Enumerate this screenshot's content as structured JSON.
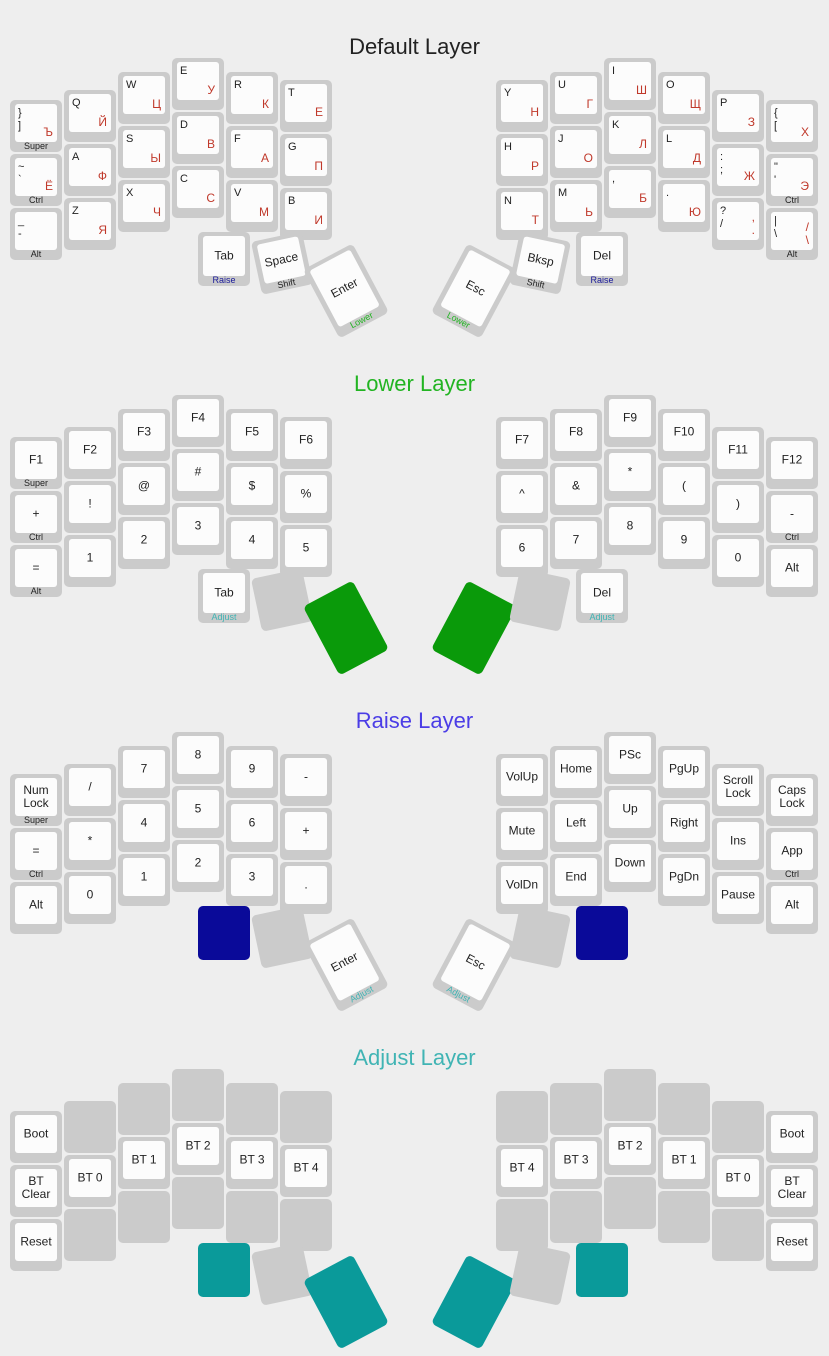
{
  "colors": {
    "default_title": "#222222",
    "lower": "#22b422",
    "lower_fill": "#0a9a0a",
    "raise": "#4b3de6",
    "raise_fill": "#0a0a99",
    "adjust": "#40b4b4",
    "adjust_fill": "#0a9a9a",
    "hold_raise": "#1a1a99",
    "hold_lower": "#22b422",
    "hold_adjust": "#40b4b4",
    "hold_plain": "#222222",
    "cyrillic": "#c0392b"
  },
  "layers": [
    {
      "title": "Default Layer",
      "color": "#222222",
      "left": [
        {
          "tl": "}\n]",
          "br": "Ъ",
          "h": "Super"
        },
        {
          "tl": "Q",
          "br": "Й"
        },
        {
          "tl": "W",
          "br": "Ц"
        },
        {
          "tl": "E",
          "br": "У"
        },
        {
          "tl": "R",
          "br": "К"
        },
        {
          "tl": "T",
          "br": "Е"
        },
        {
          "tl": "~\n`",
          "br": "Ё",
          "h": "Ctrl"
        },
        {
          "tl": "A",
          "br": "Ф"
        },
        {
          "tl": "S",
          "br": "Ы"
        },
        {
          "tl": "D",
          "br": "В"
        },
        {
          "tl": "F",
          "br": "А"
        },
        {
          "tl": "G",
          "br": "П"
        },
        {
          "tl": "_\n-",
          "h": "Alt"
        },
        {
          "tl": "Z",
          "br": "Я"
        },
        {
          "tl": "X",
          "br": "Ч"
        },
        {
          "tl": "C",
          "br": "С"
        },
        {
          "tl": "V",
          "br": "М"
        },
        {
          "tl": "B",
          "br": "И"
        }
      ],
      "left_thumbs": [
        {
          "t": "Tab",
          "h": "Raise",
          "hc": "#1a1a99"
        },
        {
          "t": "Space",
          "h": "Shift",
          "hc": "#222222"
        },
        {
          "t": "Enter",
          "h": "Lower",
          "hc": "#22b422"
        }
      ],
      "right": [
        {
          "tl": "Y",
          "br": "Н"
        },
        {
          "tl": "U",
          "br": "Г"
        },
        {
          "tl": "I",
          "br": "Ш"
        },
        {
          "tl": "O",
          "br": "Щ"
        },
        {
          "tl": "P",
          "br": "З"
        },
        {
          "tl": "{\n[",
          "br": "Х"
        },
        {
          "tl": "H",
          "br": "Р"
        },
        {
          "tl": "J",
          "br": "О"
        },
        {
          "tl": "K",
          "br": "Л"
        },
        {
          "tl": "L",
          "br": "Д"
        },
        {
          "tl": ":\n;",
          "br": "Ж"
        },
        {
          "tl": "\"\n'",
          "br": "Э",
          "h": "Ctrl"
        },
        {
          "tl": "N",
          "br": "Т"
        },
        {
          "tl": "M",
          "br": "Ь"
        },
        {
          "tl": ",",
          "br": "Б"
        },
        {
          "tl": ".",
          "br": "Ю"
        },
        {
          "tl": "?\n/",
          "br": ",\n."
        },
        {
          "tl": "|\n\\",
          "br": "/\n\\",
          "h": "Alt"
        }
      ],
      "right_thumbs": [
        {
          "t": "Esc",
          "h": "Lower",
          "hc": "#22b422"
        },
        {
          "t": "Bksp",
          "h": "Shift",
          "hc": "#222222"
        },
        {
          "t": "Del",
          "h": "Raise",
          "hc": "#1a1a99"
        }
      ]
    },
    {
      "title": "Lower Layer",
      "color": "#22b422",
      "left": [
        {
          "t": "F1",
          "h": "Super"
        },
        {
          "t": "F2"
        },
        {
          "t": "F3"
        },
        {
          "t": "F4"
        },
        {
          "t": "F5"
        },
        {
          "t": "F6"
        },
        {
          "t": "+",
          "h": "Ctrl"
        },
        {
          "t": "!"
        },
        {
          "t": "@"
        },
        {
          "t": "#"
        },
        {
          "t": "$"
        },
        {
          "t": "%"
        },
        {
          "t": "=",
          "h": "Alt"
        },
        {
          "t": "1"
        },
        {
          "t": "2"
        },
        {
          "t": "3"
        },
        {
          "t": "4"
        },
        {
          "t": "5"
        }
      ],
      "left_thumbs": [
        {
          "t": "Tab",
          "h": "Adjust",
          "hc": "#40b4b4"
        },
        {
          "blank": true
        },
        {
          "fill": "#0a9a0a"
        }
      ],
      "right": [
        {
          "t": "F7"
        },
        {
          "t": "F8"
        },
        {
          "t": "F9"
        },
        {
          "t": "F10"
        },
        {
          "t": "F11"
        },
        {
          "t": "F12"
        },
        {
          "t": "^"
        },
        {
          "t": "&"
        },
        {
          "t": "*"
        },
        {
          "t": "("
        },
        {
          "t": ")"
        },
        {
          "t": "-",
          "h": "Ctrl"
        },
        {
          "t": "6"
        },
        {
          "t": "7"
        },
        {
          "t": "8"
        },
        {
          "t": "9"
        },
        {
          "t": "0"
        },
        {
          "t": "Alt"
        }
      ],
      "right_thumbs": [
        {
          "fill": "#0a9a0a"
        },
        {
          "blank": true
        },
        {
          "t": "Del",
          "h": "Adjust",
          "hc": "#40b4b4"
        }
      ]
    },
    {
      "title": "Raise Layer",
      "color": "#4b3de6",
      "left": [
        {
          "t": "Num\nLock",
          "h": "Super"
        },
        {
          "t": "/"
        },
        {
          "t": "7"
        },
        {
          "t": "8"
        },
        {
          "t": "9"
        },
        {
          "t": "-"
        },
        {
          "t": "=",
          "h": "Ctrl"
        },
        {
          "t": "*"
        },
        {
          "t": "4"
        },
        {
          "t": "5"
        },
        {
          "t": "6"
        },
        {
          "t": "+"
        },
        {
          "t": "Alt"
        },
        {
          "t": "0"
        },
        {
          "t": "1"
        },
        {
          "t": "2"
        },
        {
          "t": "3"
        },
        {
          "t": "."
        }
      ],
      "left_thumbs": [
        {
          "fill": "#0a0a99"
        },
        {
          "blank": true
        },
        {
          "t": "Enter",
          "h": "Adjust",
          "hc": "#40b4b4"
        }
      ],
      "right": [
        {
          "t": "VolUp"
        },
        {
          "t": "Home"
        },
        {
          "t": "PSc"
        },
        {
          "t": "PgUp"
        },
        {
          "t": "Scroll\nLock"
        },
        {
          "t": "Caps\nLock"
        },
        {
          "t": "Mute"
        },
        {
          "t": "Left"
        },
        {
          "t": "Up"
        },
        {
          "t": "Right"
        },
        {
          "t": "Ins"
        },
        {
          "t": "App",
          "h": "Ctrl"
        },
        {
          "t": "VolDn"
        },
        {
          "t": "End"
        },
        {
          "t": "Down"
        },
        {
          "t": "PgDn"
        },
        {
          "t": "Pause"
        },
        {
          "t": "Alt"
        }
      ],
      "right_thumbs": [
        {
          "t": "Esc",
          "h": "Adjust",
          "hc": "#40b4b4"
        },
        {
          "blank": true
        },
        {
          "fill": "#0a0a99"
        }
      ]
    },
    {
      "title": "Adjust Layer",
      "color": "#40b4b4",
      "left": [
        {
          "t": "Boot"
        },
        {
          "blank": true
        },
        {
          "blank": true
        },
        {
          "blank": true
        },
        {
          "blank": true
        },
        {
          "blank": true
        },
        {
          "t": "BT\nClear"
        },
        {
          "t": "BT 0"
        },
        {
          "t": "BT 1"
        },
        {
          "t": "BT 2"
        },
        {
          "t": "BT 3"
        },
        {
          "t": "BT 4"
        },
        {
          "t": "Reset"
        },
        {
          "blank": true
        },
        {
          "blank": true
        },
        {
          "blank": true
        },
        {
          "blank": true
        },
        {
          "blank": true
        }
      ],
      "left_thumbs": [
        {
          "fill": "#0a9a9a"
        },
        {
          "blank": true
        },
        {
          "fill": "#0a9a9a"
        }
      ],
      "right": [
        {
          "blank": true
        },
        {
          "blank": true
        },
        {
          "blank": true
        },
        {
          "blank": true
        },
        {
          "blank": true
        },
        {
          "t": "Boot"
        },
        {
          "t": "BT 4"
        },
        {
          "t": "BT 3"
        },
        {
          "t": "BT 2"
        },
        {
          "t": "BT 1"
        },
        {
          "t": "BT 0"
        },
        {
          "t": "BT\nClear"
        },
        {
          "blank": true
        },
        {
          "blank": true
        },
        {
          "blank": true
        },
        {
          "blank": true
        },
        {
          "blank": true
        },
        {
          "t": "Reset"
        }
      ],
      "right_thumbs": [
        {
          "fill": "#0a9a9a"
        },
        {
          "blank": true
        },
        {
          "fill": "#0a9a9a"
        }
      ]
    }
  ]
}
